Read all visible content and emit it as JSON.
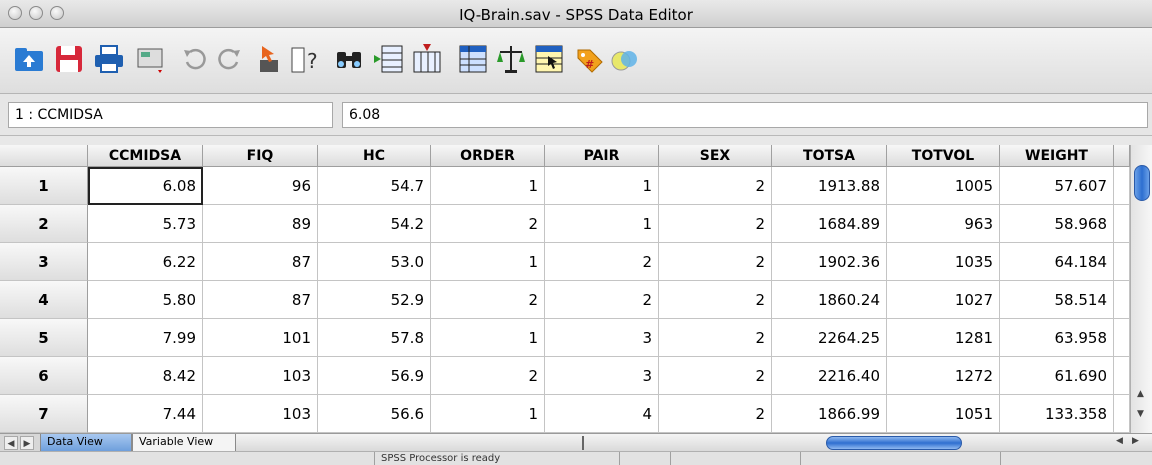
{
  "window": {
    "title": "IQ-Brain.sav - SPSS Data Editor"
  },
  "toolbar": {
    "icons": [
      "open-folder-icon",
      "save-icon",
      "print-icon",
      "dialog-recall-icon",
      "undo-icon",
      "redo-icon",
      "goto-case-icon",
      "variables-icon",
      "find-icon",
      "insert-cases-icon",
      "insert-variable-icon",
      "split-file-icon",
      "weight-cases-icon",
      "select-cases-icon",
      "value-labels-icon",
      "use-sets-icon"
    ]
  },
  "cell_info": {
    "ref": "1 : CCMIDSA",
    "value": "6.08"
  },
  "grid": {
    "columns": [
      "CCMIDSA",
      "FIQ",
      "HC",
      "ORDER",
      "PAIR",
      "SEX",
      "TOTSA",
      "TOTVOL",
      "WEIGHT"
    ],
    "rows": [
      {
        "num": "1",
        "cells": [
          "6.08",
          "96",
          "54.7",
          "1",
          "1",
          "2",
          "1913.88",
          "1005",
          "57.607"
        ]
      },
      {
        "num": "2",
        "cells": [
          "5.73",
          "89",
          "54.2",
          "2",
          "1",
          "2",
          "1684.89",
          "963",
          "58.968"
        ]
      },
      {
        "num": "3",
        "cells": [
          "6.22",
          "87",
          "53.0",
          "1",
          "2",
          "2",
          "1902.36",
          "1035",
          "64.184"
        ]
      },
      {
        "num": "4",
        "cells": [
          "5.80",
          "87",
          "52.9",
          "2",
          "2",
          "2",
          "1860.24",
          "1027",
          "58.514"
        ]
      },
      {
        "num": "5",
        "cells": [
          "7.99",
          "101",
          "57.8",
          "1",
          "3",
          "2",
          "2264.25",
          "1281",
          "63.958"
        ]
      },
      {
        "num": "6",
        "cells": [
          "8.42",
          "103",
          "56.9",
          "2",
          "3",
          "2",
          "2216.40",
          "1272",
          "61.690"
        ]
      },
      {
        "num": "7",
        "cells": [
          "7.44",
          "103",
          "56.6",
          "1",
          "4",
          "2",
          "1866.99",
          "1051",
          "133.358"
        ]
      }
    ]
  },
  "tabs": {
    "data_view": "Data View",
    "variable_view": "Variable View"
  },
  "status": {
    "text": "SPSS Processor  is ready"
  }
}
